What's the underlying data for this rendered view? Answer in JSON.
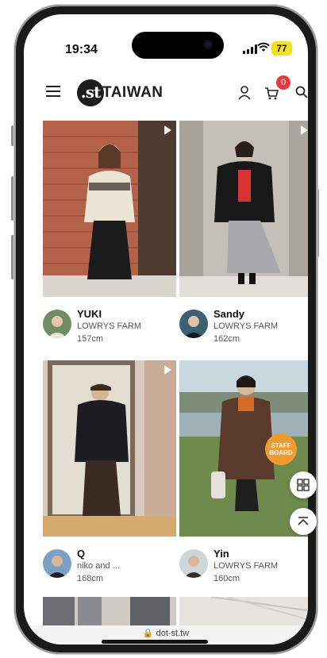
{
  "status_bar": {
    "time": "19:34",
    "battery": "77"
  },
  "header": {
    "logo_mark": ".st",
    "logo_text": "TAIWAN",
    "cart_count": "0"
  },
  "feed": [
    {
      "name": "YUKI",
      "brand": "LOWRYS FARM",
      "height": "157cm"
    },
    {
      "name": "Sandy",
      "brand": "LOWRYS FARM",
      "height": "162cm"
    },
    {
      "name": "Q",
      "brand": "niko and ...",
      "height": "168cm"
    },
    {
      "name": "Yin",
      "brand": "LOWRYS FARM",
      "height": "160cm"
    }
  ],
  "floating": {
    "staff_line1": "STAFF",
    "staff_line2": "BOARD"
  },
  "browser": {
    "url": "dot-st.tw"
  },
  "colors": {
    "badge": "#e8393a",
    "staff_board": "#f29a2e",
    "battery": "#f6e023"
  }
}
